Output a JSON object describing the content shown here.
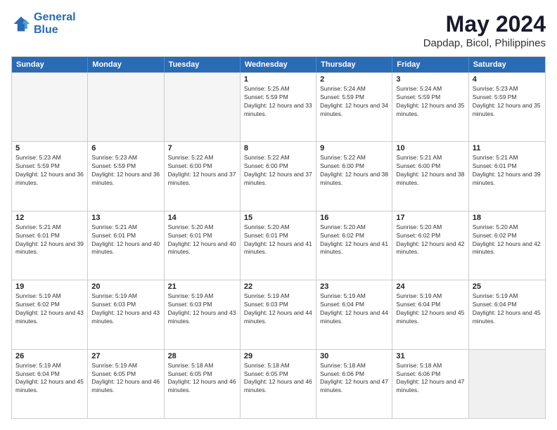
{
  "logo": {
    "line1": "General",
    "line2": "Blue"
  },
  "title": "May 2024",
  "subtitle": "Dapdap, Bicol, Philippines",
  "header_days": [
    "Sunday",
    "Monday",
    "Tuesday",
    "Wednesday",
    "Thursday",
    "Friday",
    "Saturday"
  ],
  "weeks": [
    [
      {
        "day": "",
        "sunrise": "",
        "sunset": "",
        "daylight": "",
        "empty": true
      },
      {
        "day": "",
        "sunrise": "",
        "sunset": "",
        "daylight": "",
        "empty": true
      },
      {
        "day": "",
        "sunrise": "",
        "sunset": "",
        "daylight": "",
        "empty": true
      },
      {
        "day": "1",
        "sunrise": "Sunrise: 5:25 AM",
        "sunset": "Sunset: 5:59 PM",
        "daylight": "Daylight: 12 hours and 33 minutes."
      },
      {
        "day": "2",
        "sunrise": "Sunrise: 5:24 AM",
        "sunset": "Sunset: 5:59 PM",
        "daylight": "Daylight: 12 hours and 34 minutes."
      },
      {
        "day": "3",
        "sunrise": "Sunrise: 5:24 AM",
        "sunset": "Sunset: 5:59 PM",
        "daylight": "Daylight: 12 hours and 35 minutes."
      },
      {
        "day": "4",
        "sunrise": "Sunrise: 5:23 AM",
        "sunset": "Sunset: 5:59 PM",
        "daylight": "Daylight: 12 hours and 35 minutes."
      }
    ],
    [
      {
        "day": "5",
        "sunrise": "Sunrise: 5:23 AM",
        "sunset": "Sunset: 5:59 PM",
        "daylight": "Daylight: 12 hours and 36 minutes."
      },
      {
        "day": "6",
        "sunrise": "Sunrise: 5:23 AM",
        "sunset": "Sunset: 5:59 PM",
        "daylight": "Daylight: 12 hours and 36 minutes."
      },
      {
        "day": "7",
        "sunrise": "Sunrise: 5:22 AM",
        "sunset": "Sunset: 6:00 PM",
        "daylight": "Daylight: 12 hours and 37 minutes."
      },
      {
        "day": "8",
        "sunrise": "Sunrise: 5:22 AM",
        "sunset": "Sunset: 6:00 PM",
        "daylight": "Daylight: 12 hours and 37 minutes."
      },
      {
        "day": "9",
        "sunrise": "Sunrise: 5:22 AM",
        "sunset": "Sunset: 6:00 PM",
        "daylight": "Daylight: 12 hours and 38 minutes."
      },
      {
        "day": "10",
        "sunrise": "Sunrise: 5:21 AM",
        "sunset": "Sunset: 6:00 PM",
        "daylight": "Daylight: 12 hours and 38 minutes."
      },
      {
        "day": "11",
        "sunrise": "Sunrise: 5:21 AM",
        "sunset": "Sunset: 6:01 PM",
        "daylight": "Daylight: 12 hours and 39 minutes."
      }
    ],
    [
      {
        "day": "12",
        "sunrise": "Sunrise: 5:21 AM",
        "sunset": "Sunset: 6:01 PM",
        "daylight": "Daylight: 12 hours and 39 minutes."
      },
      {
        "day": "13",
        "sunrise": "Sunrise: 5:21 AM",
        "sunset": "Sunset: 6:01 PM",
        "daylight": "Daylight: 12 hours and 40 minutes."
      },
      {
        "day": "14",
        "sunrise": "Sunrise: 5:20 AM",
        "sunset": "Sunset: 6:01 PM",
        "daylight": "Daylight: 12 hours and 40 minutes."
      },
      {
        "day": "15",
        "sunrise": "Sunrise: 5:20 AM",
        "sunset": "Sunset: 6:01 PM",
        "daylight": "Daylight: 12 hours and 41 minutes."
      },
      {
        "day": "16",
        "sunrise": "Sunrise: 5:20 AM",
        "sunset": "Sunset: 6:02 PM",
        "daylight": "Daylight: 12 hours and 41 minutes."
      },
      {
        "day": "17",
        "sunrise": "Sunrise: 5:20 AM",
        "sunset": "Sunset: 6:02 PM",
        "daylight": "Daylight: 12 hours and 42 minutes."
      },
      {
        "day": "18",
        "sunrise": "Sunrise: 5:20 AM",
        "sunset": "Sunset: 6:02 PM",
        "daylight": "Daylight: 12 hours and 42 minutes."
      }
    ],
    [
      {
        "day": "19",
        "sunrise": "Sunrise: 5:19 AM",
        "sunset": "Sunset: 6:02 PM",
        "daylight": "Daylight: 12 hours and 43 minutes."
      },
      {
        "day": "20",
        "sunrise": "Sunrise: 5:19 AM",
        "sunset": "Sunset: 6:03 PM",
        "daylight": "Daylight: 12 hours and 43 minutes."
      },
      {
        "day": "21",
        "sunrise": "Sunrise: 5:19 AM",
        "sunset": "Sunset: 6:03 PM",
        "daylight": "Daylight: 12 hours and 43 minutes."
      },
      {
        "day": "22",
        "sunrise": "Sunrise: 5:19 AM",
        "sunset": "Sunset: 6:03 PM",
        "daylight": "Daylight: 12 hours and 44 minutes."
      },
      {
        "day": "23",
        "sunrise": "Sunrise: 5:19 AM",
        "sunset": "Sunset: 6:04 PM",
        "daylight": "Daylight: 12 hours and 44 minutes."
      },
      {
        "day": "24",
        "sunrise": "Sunrise: 5:19 AM",
        "sunset": "Sunset: 6:04 PM",
        "daylight": "Daylight: 12 hours and 45 minutes."
      },
      {
        "day": "25",
        "sunrise": "Sunrise: 5:19 AM",
        "sunset": "Sunset: 6:04 PM",
        "daylight": "Daylight: 12 hours and 45 minutes."
      }
    ],
    [
      {
        "day": "26",
        "sunrise": "Sunrise: 5:19 AM",
        "sunset": "Sunset: 6:04 PM",
        "daylight": "Daylight: 12 hours and 45 minutes."
      },
      {
        "day": "27",
        "sunrise": "Sunrise: 5:19 AM",
        "sunset": "Sunset: 6:05 PM",
        "daylight": "Daylight: 12 hours and 46 minutes."
      },
      {
        "day": "28",
        "sunrise": "Sunrise: 5:18 AM",
        "sunset": "Sunset: 6:05 PM",
        "daylight": "Daylight: 12 hours and 46 minutes."
      },
      {
        "day": "29",
        "sunrise": "Sunrise: 5:18 AM",
        "sunset": "Sunset: 6:05 PM",
        "daylight": "Daylight: 12 hours and 46 minutes."
      },
      {
        "day": "30",
        "sunrise": "Sunrise: 5:18 AM",
        "sunset": "Sunset: 6:06 PM",
        "daylight": "Daylight: 12 hours and 47 minutes."
      },
      {
        "day": "31",
        "sunrise": "Sunrise: 5:18 AM",
        "sunset": "Sunset: 6:06 PM",
        "daylight": "Daylight: 12 hours and 47 minutes."
      },
      {
        "day": "",
        "sunrise": "",
        "sunset": "",
        "daylight": "",
        "empty": true
      }
    ]
  ]
}
